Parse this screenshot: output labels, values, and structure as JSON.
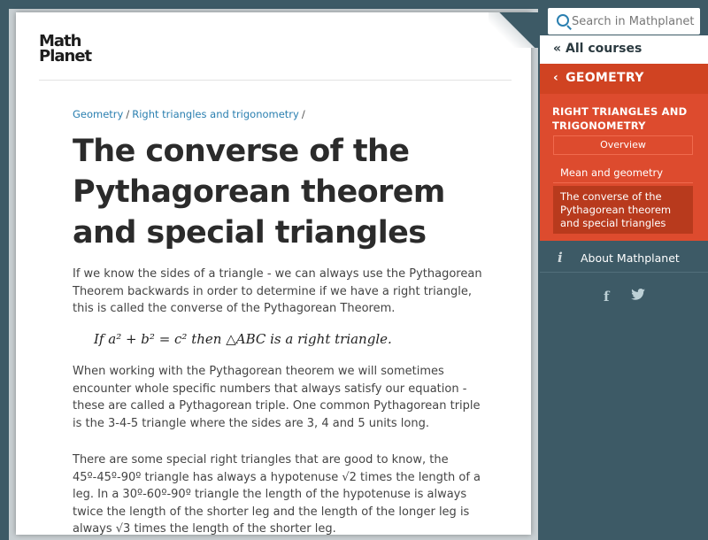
{
  "header": {
    "logo_line1": "Math",
    "logo_line2": "Planet"
  },
  "breadcrumb": {
    "items": [
      "Geometry",
      "Right triangles and trigonometry"
    ],
    "separator": "/"
  },
  "article": {
    "title": "The converse of the Pythagorean theorem and special triangles",
    "paragraph1": "If we know the sides of a triangle - we can always use the Pythagorean Theorem backwards in order to determine if we have a right triangle, this is called the converse of the Pythagorean Theorem.",
    "formula": "If a² + b² = c² then △ABC is a right triangle.",
    "paragraph2": "When working with the Pythagorean theorem we will sometimes encounter whole specific numbers that always satisfy our equation - these are called a Pythagorean triple. One common Pythagorean triple is the 3-4-5 triangle where the sides are 3, 4 and 5 units long.",
    "paragraph3": "There are some special right triangles that are good to know, the 45º-45º-90º triangle has always a hypotenuse √2 times the length of a leg. In a 30º-60º-90º triangle the length of the hypotenuse is always twice the length of the shorter leg and the length of the longer leg is always √3 times the length of the shorter leg."
  },
  "sidebar": {
    "search_placeholder": "Search in Mathplanet",
    "all_courses_label": "All courses",
    "all_courses_icon": "double-chevron-left-icon",
    "course_label": "GEOMETRY",
    "course_icon": "chevron-left-icon",
    "section_title": "RIGHT TRIANGLES AND TRIGONOMETRY",
    "overview_label": "Overview",
    "items": [
      {
        "label": "Mean and geometry",
        "active": false
      },
      {
        "label": "The converse of the Pythagorean theorem and special triangles",
        "active": true
      }
    ],
    "about_label": "About Mathplanet",
    "about_icon": "info-icon",
    "social": [
      "facebook-icon",
      "twitter-icon"
    ]
  },
  "colors": {
    "sidebar_bg": "#3d5a66",
    "accent_red": "#dd4b2e",
    "active_item": "#b83a1d",
    "link_blue": "#2a7fb0"
  }
}
